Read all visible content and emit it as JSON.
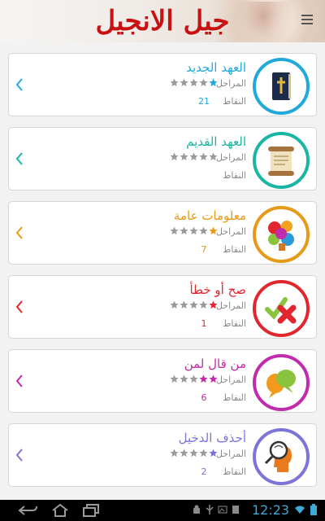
{
  "app": {
    "title": "جيل الانجيل"
  },
  "labels": {
    "stages": "المراحل",
    "points": "النقاط"
  },
  "colors": {
    "title": "#c81212"
  },
  "categories": [
    {
      "name": "العهد الجديد",
      "color": "#21a9d9",
      "stars_filled": 1,
      "stars_total": 5,
      "points": "21",
      "icon": "bible-icon"
    },
    {
      "name": "العهد القديم",
      "color": "#1ab5a3",
      "stars_filled": 0,
      "stars_total": 5,
      "points": "",
      "icon": "scroll-icon"
    },
    {
      "name": "معلومات عامة",
      "color": "#e69a17",
      "stars_filled": 1,
      "stars_total": 5,
      "points": "7",
      "icon": "info-puzzle-icon"
    },
    {
      "name": "صح أو خطأ",
      "color": "#e2262e",
      "stars_filled": 1,
      "stars_total": 5,
      "points": "1",
      "icon": "true-false-icon"
    },
    {
      "name": "من قال لمن",
      "color": "#c02cab",
      "stars_filled": 2,
      "stars_total": 5,
      "points": "6",
      "icon": "speech-bubbles-icon"
    },
    {
      "name": "أحذف الدخيل",
      "color": "#7c74d9",
      "stars_filled": 1,
      "stars_total": 5,
      "points": "2",
      "icon": "magnifier-head-icon"
    }
  ],
  "status_bar": {
    "time": "12:23"
  }
}
